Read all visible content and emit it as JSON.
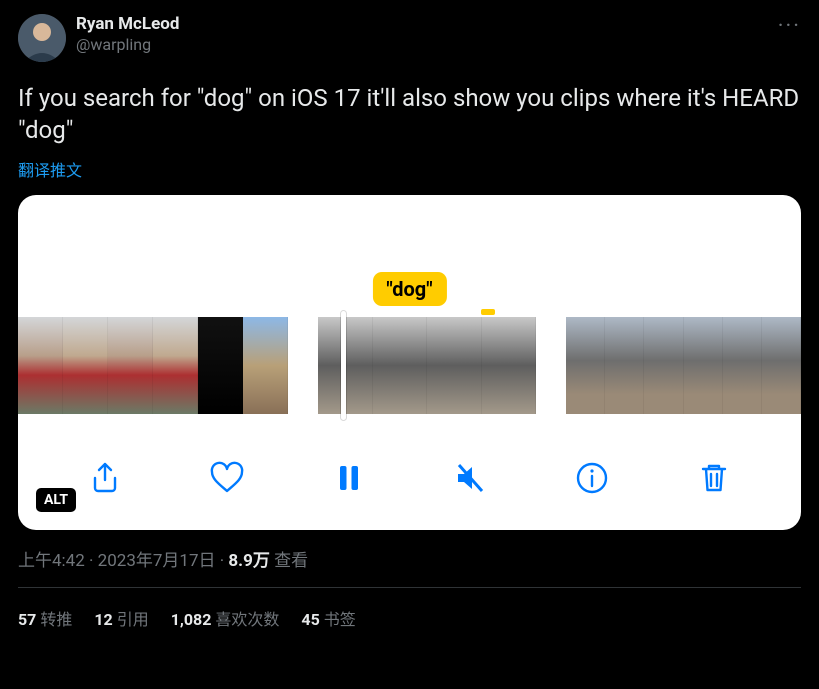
{
  "author": {
    "display_name": "Ryan McLeod",
    "handle": "@warpling"
  },
  "more_label": "···",
  "tweet_text": "If you search for \"dog\" on iOS 17 it'll also show you clips where it's HEARD \"dog\"",
  "translate_label": "翻译推文",
  "media": {
    "dog_tag": "\"dog\"",
    "alt_badge": "ALT",
    "icons": {
      "share": "share-icon",
      "heart": "heart-icon",
      "pause": "pause-icon",
      "mute": "mute-icon",
      "info": "info-icon",
      "trash": "trash-icon"
    }
  },
  "meta": {
    "time": "上午4:42",
    "sep": " · ",
    "date": "2023年7月17日",
    "views_count": "8.9万",
    "views_label": " 查看"
  },
  "engagement": {
    "retweets_count": "57",
    "retweets_label": "转推",
    "quotes_count": "12",
    "quotes_label": "引用",
    "likes_count": "1,082",
    "likes_label": "喜欢次数",
    "bookmarks_count": "45",
    "bookmarks_label": "书签"
  }
}
